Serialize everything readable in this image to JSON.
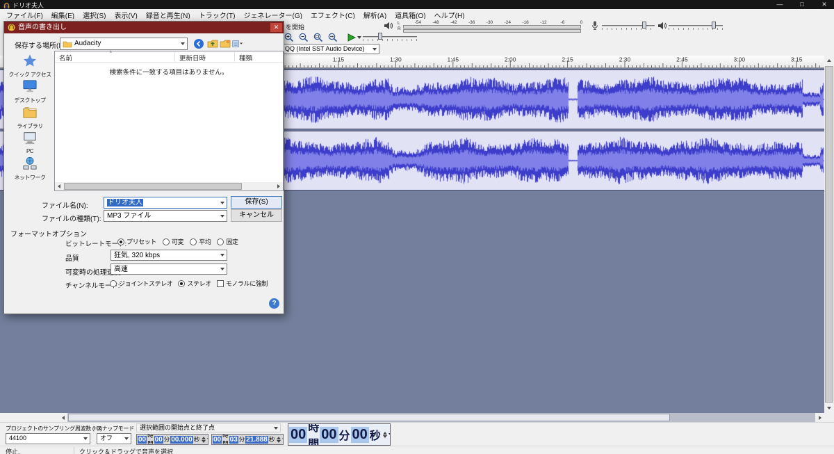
{
  "window": {
    "title": "ドリオ夫人",
    "minimize": "—",
    "maximize": "□",
    "close": "✕"
  },
  "menu": {
    "items": [
      "ファイル(F)",
      "編集(E)",
      "選択(S)",
      "表示(V)",
      "録音と再生(N)",
      "トラック(T)",
      "ジェネレーター(G)",
      "エフェクト(C)",
      "解析(A)",
      "道具箱(O)",
      "ヘルプ(H)"
    ]
  },
  "toolbar": {
    "monitor_text": "を開始",
    "meter_scale": [
      "-54",
      "-48",
      "-42",
      "-36",
      "-30",
      "-24",
      "-18",
      "-12",
      "-6",
      "0"
    ],
    "meter_channels": [
      "L",
      "R"
    ],
    "device_value": "QQ (Intel SST Audio Device)"
  },
  "ruler": {
    "labels": [
      "1:15",
      "1:30",
      "1:45",
      "2:00",
      "2:15",
      "2:30",
      "2:45",
      "3:00",
      "3:15"
    ]
  },
  "dialog": {
    "title": "音声の書き出し",
    "close": "✕",
    "location_label": "保存する場所(I):",
    "location_value": "Audacity",
    "sidebar": [
      {
        "label": "クイック アクセス",
        "icon": "star-icon"
      },
      {
        "label": "デスクトップ",
        "icon": "desktop-icon"
      },
      {
        "label": "ライブラリ",
        "icon": "library-icon"
      },
      {
        "label": "PC",
        "icon": "pc-icon"
      },
      {
        "label": "ネットワーク",
        "icon": "network-icon"
      }
    ],
    "list": {
      "columns": [
        "名前",
        "更新日時",
        "種類"
      ],
      "sort": "∧",
      "empty": "検索条件に一致する項目はありません。"
    },
    "filename_label": "ファイル名(N):",
    "filename_value": "ドリオ夫人",
    "filetype_label": "ファイルの種類(T):",
    "filetype_value": "MP3 ファイル",
    "save": "保存(S)",
    "cancel": "キャンセル",
    "format": {
      "section": "フォーマットオプション",
      "bitrate_label": "ビットレートモード:",
      "bitrate_options": [
        {
          "label": "プリセット",
          "selected": true
        },
        {
          "label": "可変",
          "selected": false
        },
        {
          "label": "平均",
          "selected": false
        },
        {
          "label": "固定",
          "selected": false
        }
      ],
      "quality_label": "品質",
      "quality_value": "狂気, 320 kbps",
      "speed_label": "可変時の処理速度",
      "speed_value": "高速",
      "channel_label": "チャンネルモード:",
      "channel_options": [
        {
          "label": "ジョイントステレオ",
          "selected": false
        },
        {
          "label": "ステレオ",
          "selected": true
        }
      ],
      "mono_checkbox": "モノラルに強制"
    },
    "help": "?"
  },
  "bottom": {
    "rate_label": "プロジェクトのサンプリング周波数 (Hz)",
    "rate_value": "44100",
    "snap_label": "スナップモード",
    "snap_value": "オフ",
    "selmode": "選択範囲の開始点と終了点",
    "sel_start_segments": [
      {
        "t": "00",
        "d": 1
      },
      {
        "t": "時間",
        "d": 0
      },
      {
        "t": "00",
        "d": 1
      },
      {
        "t": "分",
        "d": 0
      },
      {
        "t": "00.000",
        "d": 1
      },
      {
        "t": "秒",
        "d": 0
      }
    ],
    "sel_end_segments": [
      {
        "t": "00",
        "d": 1
      },
      {
        "t": "時間",
        "d": 0
      },
      {
        "t": "03",
        "d": 1
      },
      {
        "t": "分",
        "d": 0
      },
      {
        "t": "21.888",
        "d": 1
      },
      {
        "t": "秒",
        "d": 0
      }
    ],
    "position_segments": [
      {
        "t": "00",
        "d": 1
      },
      {
        "t": "時間",
        "d": 0
      },
      {
        "t": "00",
        "d": 1
      },
      {
        "t": "分",
        "d": 0
      },
      {
        "t": "00",
        "d": 1
      },
      {
        "t": "秒",
        "d": 0
      }
    ]
  },
  "status": {
    "left": "停止.",
    "hint": "クリック＆ドラッグで音声を選択"
  },
  "colors": {
    "waveform": "#3d3dcc",
    "track_bg": "#e2e2f5",
    "canvas_bg": "#737f9c",
    "dialog_title": "#7c2020"
  }
}
